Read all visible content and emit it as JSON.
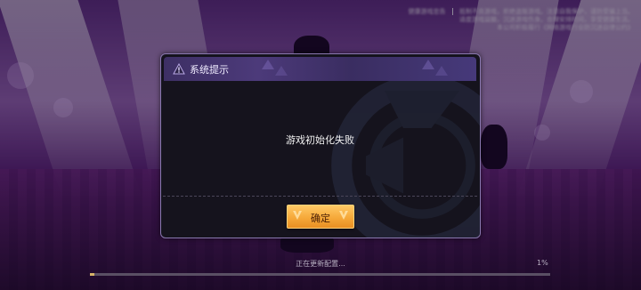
{
  "notice": {
    "line1_left": "健康游戏忠告",
    "line1_right": "抵制不良游戏，拒绝盗版游戏。注意自我保护，谨防受骗上当。",
    "line2": "适度游戏益脑，沉迷游戏伤身。合理安排时间，享受健康生活。",
    "line3": "本公司积极履行《网络游戏行业防沉迷自律公约》"
  },
  "dialog": {
    "title": "系统提示",
    "message": "游戏初始化失败",
    "confirm_label": "确定"
  },
  "loading": {
    "status_text": "正在更新配置...",
    "percent_text": "1%",
    "progress": 0.01
  },
  "colors": {
    "dialog_bg": "#15131d",
    "header": "#4c3a7a",
    "button": "#f6a93a",
    "progress_fill": "#d7b46a"
  }
}
